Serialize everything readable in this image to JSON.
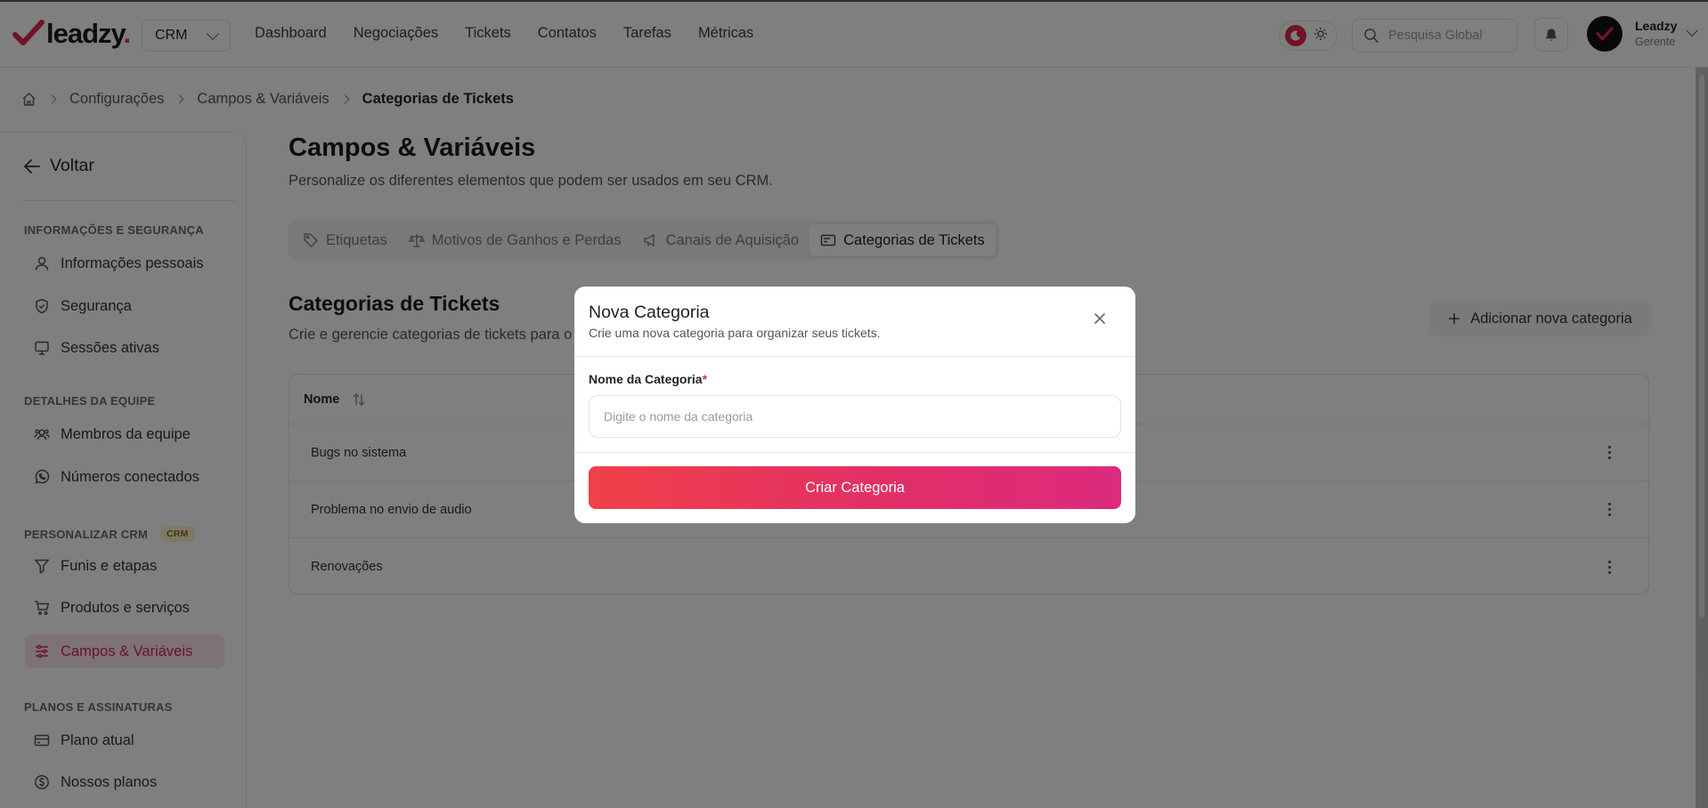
{
  "app": {
    "logo_text": "leadzy",
    "logo_dot": ".",
    "workspace_select": "CRM",
    "nav": [
      "Dashboard",
      "Negociações",
      "Tickets",
      "Contatos",
      "Tarefas",
      "Métricas"
    ],
    "search_placeholder": "Pesquisa Global",
    "user_name": "Leadzy",
    "user_role": "Gerente",
    "accent": "#e0284a"
  },
  "breadcrumb": [
    "Configurações",
    "Campos & Variáveis",
    "Categorias de Tickets"
  ],
  "sidebar": {
    "back_label": "Voltar",
    "sections": [
      {
        "title": "INFORMAÇÕES E SEGURANÇA",
        "items": [
          "Informações pessoais",
          "Segurança",
          "Sessões ativas"
        ]
      },
      {
        "title": "DETALHES DA EQUIPE",
        "items": [
          "Membros da equipe",
          "Números conectados"
        ]
      },
      {
        "title": "PERSONALIZAR CRM",
        "badge": "CRM",
        "items": [
          "Funis e etapas",
          "Produtos e serviços",
          "Campos & Variáveis"
        ]
      },
      {
        "title": "PLANOS E ASSINATURAS",
        "items": [
          "Plano atual",
          "Nossos planos"
        ]
      }
    ],
    "active_item": "Campos & Variáveis"
  },
  "main": {
    "title": "Campos & Variáveis",
    "subtitle": "Personalize os diferentes elementos que podem ser usados em seu CRM.",
    "tabs": [
      "Etiquetas",
      "Motivos de Ganhos e Perdas",
      "Canais de Aquisição",
      "Categorias de Tickets"
    ],
    "active_tab": "Categorias de Tickets",
    "section_title": "Categorias de Tickets",
    "section_subtitle": "Crie e gerencie categorias de tickets para o",
    "add_button": "Adicionar nova categoria",
    "table": {
      "column": "Nome",
      "rows": [
        "Bugs no sistema",
        "Problema no envio de audio",
        "Renovações"
      ]
    }
  },
  "modal": {
    "title": "Nova Categoria",
    "subtitle": "Crie uma nova categoria para organizar seus tickets.",
    "field_label": "Nome da Categoria",
    "required_mark": "*",
    "field_placeholder": "Digite o nome da categoria",
    "field_value": "",
    "submit_label": "Criar Categoria"
  }
}
